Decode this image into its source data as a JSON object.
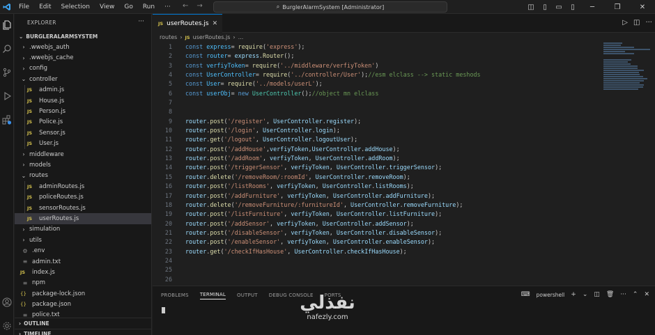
{
  "titlebar": {
    "menu": [
      "File",
      "Edit",
      "Selection",
      "View",
      "Go",
      "Run",
      "···"
    ],
    "search_text": "BurglerAlarmSystem [Administrator]"
  },
  "sidebar": {
    "title": "EXPLORER",
    "dots": "···",
    "root": "BURGLERALARMSYSTEM",
    "items": [
      {
        "label": ".wwebjs_auth",
        "kind": "folder",
        "depth": 0,
        "open": false
      },
      {
        "label": ".wwebjs_cache",
        "kind": "folder",
        "depth": 0,
        "open": false
      },
      {
        "label": "config",
        "kind": "folder",
        "depth": 0,
        "open": false
      },
      {
        "label": "controller",
        "kind": "folder",
        "depth": 0,
        "open": true
      },
      {
        "label": "admin.js",
        "kind": "js",
        "depth": 1
      },
      {
        "label": "House.js",
        "kind": "js",
        "depth": 1
      },
      {
        "label": "Person.js",
        "kind": "js",
        "depth": 1
      },
      {
        "label": "Police.js",
        "kind": "js",
        "depth": 1
      },
      {
        "label": "Sensor.js",
        "kind": "js",
        "depth": 1
      },
      {
        "label": "User.js",
        "kind": "js",
        "depth": 1
      },
      {
        "label": "middleware",
        "kind": "folder",
        "depth": 0,
        "open": false
      },
      {
        "label": "models",
        "kind": "folder",
        "depth": 0,
        "open": false
      },
      {
        "label": "routes",
        "kind": "folder",
        "depth": 0,
        "open": true
      },
      {
        "label": "adminRoutes.js",
        "kind": "js",
        "depth": 1
      },
      {
        "label": "policeRoutes.js",
        "kind": "js",
        "depth": 1
      },
      {
        "label": "sensorRoutes.js",
        "kind": "js",
        "depth": 1
      },
      {
        "label": "userRoutes.js",
        "kind": "js",
        "depth": 1,
        "selected": true
      },
      {
        "label": "simulation",
        "kind": "folder",
        "depth": 0,
        "open": false
      },
      {
        "label": "utils",
        "kind": "folder",
        "depth": 0,
        "open": false
      },
      {
        "label": ".env",
        "kind": "env",
        "depth": 0
      },
      {
        "label": "admin.txt",
        "kind": "txt",
        "depth": 0
      },
      {
        "label": "index.js",
        "kind": "js",
        "depth": 0
      },
      {
        "label": "npm",
        "kind": "txt",
        "depth": 0
      },
      {
        "label": "package-lock.json",
        "kind": "json",
        "depth": 0
      },
      {
        "label": "package.json",
        "kind": "json",
        "depth": 0
      },
      {
        "label": "police.txt",
        "kind": "txt",
        "depth": 0
      }
    ],
    "outline": "OUTLINE",
    "timeline": "TIMELINE"
  },
  "editor": {
    "tab_label": "userRoutes.js",
    "tab_icon": "JS",
    "breadcrumb": [
      "routes",
      "userRoutes.js",
      "..."
    ],
    "lines": [
      [
        [
          "kw",
          "const "
        ],
        [
          "var",
          "express"
        ],
        [
          "",
          "= "
        ],
        [
          "fn",
          "require"
        ],
        [
          "",
          "("
        ],
        [
          "str",
          "'express'"
        ],
        [
          "",
          ");"
        ]
      ],
      [
        [
          "kw",
          "const "
        ],
        [
          "var",
          "router"
        ],
        [
          "",
          "= "
        ],
        [
          "pl",
          "express"
        ],
        [
          "",
          "."
        ],
        [
          "fn",
          "Router"
        ],
        [
          "",
          "();"
        ]
      ],
      [
        [
          "kw",
          "const "
        ],
        [
          "var",
          "verfiyToken"
        ],
        [
          "",
          "= "
        ],
        [
          "fn",
          "require"
        ],
        [
          "",
          "("
        ],
        [
          "str",
          "'../middleware/verfiyToken'"
        ],
        [
          "",
          ")"
        ]
      ],
      [
        [
          "kw",
          "const "
        ],
        [
          "var",
          "UserController"
        ],
        [
          "",
          "= "
        ],
        [
          "fn",
          "require"
        ],
        [
          "",
          "("
        ],
        [
          "str",
          "'../controller/User'"
        ],
        [
          "",
          ");"
        ],
        [
          "cm",
          "//esm elclass --> static meshods"
        ]
      ],
      [
        [
          "kw",
          "const "
        ],
        [
          "var",
          "User"
        ],
        [
          "",
          "= "
        ],
        [
          "fn",
          "require"
        ],
        [
          "",
          "("
        ],
        [
          "str",
          "'../models/userL'"
        ],
        [
          "",
          ");"
        ]
      ],
      [
        [
          "kw",
          "const "
        ],
        [
          "var",
          "userObj"
        ],
        [
          "",
          "= "
        ],
        [
          "kw",
          "new "
        ],
        [
          "cls",
          "UserController"
        ],
        [
          "",
          "();"
        ],
        [
          "cm",
          "//object mn elclass"
        ]
      ],
      [],
      [],
      [
        [
          "pl",
          "router"
        ],
        [
          "",
          "."
        ],
        [
          "fn",
          "post"
        ],
        [
          "",
          "("
        ],
        [
          "str",
          "'/register'"
        ],
        [
          "",
          ", "
        ],
        [
          "pl",
          "UserController"
        ],
        [
          "",
          "."
        ],
        [
          "pl",
          "register"
        ],
        [
          "",
          ");"
        ]
      ],
      [
        [
          "pl",
          "router"
        ],
        [
          "",
          "."
        ],
        [
          "fn",
          "post"
        ],
        [
          "",
          "("
        ],
        [
          "str",
          "'/login'"
        ],
        [
          "",
          ", "
        ],
        [
          "pl",
          "UserController"
        ],
        [
          "",
          "."
        ],
        [
          "pl",
          "login"
        ],
        [
          "",
          ");"
        ]
      ],
      [
        [
          "pl",
          "router"
        ],
        [
          "",
          "."
        ],
        [
          "fn",
          "get"
        ],
        [
          "",
          "("
        ],
        [
          "str",
          "'/logout'"
        ],
        [
          "",
          ", "
        ],
        [
          "pl",
          "UserController"
        ],
        [
          "",
          "."
        ],
        [
          "pl",
          "logoutUser"
        ],
        [
          "",
          ");"
        ]
      ],
      [
        [
          "pl",
          "router"
        ],
        [
          "",
          "."
        ],
        [
          "fn",
          "post"
        ],
        [
          "",
          "("
        ],
        [
          "str",
          "'/addHouse'"
        ],
        [
          "",
          ","
        ],
        [
          "pl",
          "verfiyToken"
        ],
        [
          "",
          ","
        ],
        [
          "pl",
          "UserController"
        ],
        [
          "",
          "."
        ],
        [
          "pl",
          "addHouse"
        ],
        [
          "",
          ");"
        ]
      ],
      [
        [
          "pl",
          "router"
        ],
        [
          "",
          "."
        ],
        [
          "fn",
          "post"
        ],
        [
          "",
          "("
        ],
        [
          "str",
          "'/addRoom'"
        ],
        [
          "",
          ", "
        ],
        [
          "pl",
          "verfiyToken"
        ],
        [
          "",
          ", "
        ],
        [
          "pl",
          "UserController"
        ],
        [
          "",
          "."
        ],
        [
          "pl",
          "addRoom"
        ],
        [
          "",
          ");"
        ]
      ],
      [
        [
          "pl",
          "router"
        ],
        [
          "",
          "."
        ],
        [
          "fn",
          "post"
        ],
        [
          "",
          "("
        ],
        [
          "str",
          "'/triggerSensor'"
        ],
        [
          "",
          ", "
        ],
        [
          "pl",
          "verfiyToken"
        ],
        [
          "",
          ", "
        ],
        [
          "pl",
          "UserController"
        ],
        [
          "",
          "."
        ],
        [
          "pl",
          "triggerSensor"
        ],
        [
          "",
          ");"
        ]
      ],
      [
        [
          "pl",
          "router"
        ],
        [
          "",
          "."
        ],
        [
          "fn",
          "delete"
        ],
        [
          "",
          "("
        ],
        [
          "str",
          "'/removeRoom/:roomId'"
        ],
        [
          "",
          ", "
        ],
        [
          "pl",
          "UserController"
        ],
        [
          "",
          "."
        ],
        [
          "pl",
          "removeRoom"
        ],
        [
          "",
          ");"
        ]
      ],
      [
        [
          "pl",
          "router"
        ],
        [
          "",
          "."
        ],
        [
          "fn",
          "post"
        ],
        [
          "",
          "("
        ],
        [
          "str",
          "'/listRooms'"
        ],
        [
          "",
          ", "
        ],
        [
          "pl",
          "verfiyToken"
        ],
        [
          "",
          ", "
        ],
        [
          "pl",
          "UserController"
        ],
        [
          "",
          "."
        ],
        [
          "pl",
          "listRooms"
        ],
        [
          "",
          ");"
        ]
      ],
      [
        [
          "pl",
          "router"
        ],
        [
          "",
          "."
        ],
        [
          "fn",
          "post"
        ],
        [
          "",
          "("
        ],
        [
          "str",
          "'/addFurniture'"
        ],
        [
          "",
          ", "
        ],
        [
          "pl",
          "verfiyToken"
        ],
        [
          "",
          ", "
        ],
        [
          "pl",
          "UserController"
        ],
        [
          "",
          "."
        ],
        [
          "pl",
          "addFurniture"
        ],
        [
          "",
          ");"
        ]
      ],
      [
        [
          "pl",
          "router"
        ],
        [
          "",
          "."
        ],
        [
          "fn",
          "delete"
        ],
        [
          "",
          "("
        ],
        [
          "str",
          "'/removeFurniture/:furnitureId'"
        ],
        [
          "",
          ", "
        ],
        [
          "pl",
          "UserController"
        ],
        [
          "",
          "."
        ],
        [
          "pl",
          "removeFurniture"
        ],
        [
          "",
          ");"
        ]
      ],
      [
        [
          "pl",
          "router"
        ],
        [
          "",
          "."
        ],
        [
          "fn",
          "post"
        ],
        [
          "",
          "("
        ],
        [
          "str",
          "'/listFurniture'"
        ],
        [
          "",
          ", "
        ],
        [
          "pl",
          "verfiyToken"
        ],
        [
          "",
          ", "
        ],
        [
          "pl",
          "UserController"
        ],
        [
          "",
          "."
        ],
        [
          "pl",
          "listFurniture"
        ],
        [
          "",
          ");"
        ]
      ],
      [
        [
          "pl",
          "router"
        ],
        [
          "",
          "."
        ],
        [
          "fn",
          "post"
        ],
        [
          "",
          "("
        ],
        [
          "str",
          "'/addSensor'"
        ],
        [
          "",
          ", "
        ],
        [
          "pl",
          "verfiyToken"
        ],
        [
          "",
          ", "
        ],
        [
          "pl",
          "UserController"
        ],
        [
          "",
          "."
        ],
        [
          "pl",
          "addSensor"
        ],
        [
          "",
          ");"
        ]
      ],
      [
        [
          "pl",
          "router"
        ],
        [
          "",
          "."
        ],
        [
          "fn",
          "post"
        ],
        [
          "",
          "("
        ],
        [
          "str",
          "'/disableSensor'"
        ],
        [
          "",
          ", "
        ],
        [
          "pl",
          "verfiyToken"
        ],
        [
          "",
          ", "
        ],
        [
          "pl",
          "UserController"
        ],
        [
          "",
          "."
        ],
        [
          "pl",
          "disableSensor"
        ],
        [
          "",
          ");"
        ]
      ],
      [
        [
          "pl",
          "router"
        ],
        [
          "",
          "."
        ],
        [
          "fn",
          "post"
        ],
        [
          "",
          "("
        ],
        [
          "str",
          "'/enableSensor'"
        ],
        [
          "",
          ", "
        ],
        [
          "pl",
          "verfiyToken"
        ],
        [
          "",
          ", "
        ],
        [
          "pl",
          "UserController"
        ],
        [
          "",
          "."
        ],
        [
          "pl",
          "enableSensor"
        ],
        [
          "",
          ");"
        ]
      ],
      [
        [
          "pl",
          "router"
        ],
        [
          "",
          "."
        ],
        [
          "fn",
          "get"
        ],
        [
          "",
          "("
        ],
        [
          "str",
          "'/checkIfHasHouse'"
        ],
        [
          "",
          ", "
        ],
        [
          "pl",
          "UserController"
        ],
        [
          "",
          "."
        ],
        [
          "pl",
          "checkIfHasHouse"
        ],
        [
          "",
          ");"
        ]
      ],
      [],
      [],
      []
    ]
  },
  "panel": {
    "tabs": [
      "PROBLEMS",
      "TERMINAL",
      "OUTPUT",
      "DEBUG CONSOLE",
      "PORTS"
    ],
    "active_tab": "TERMINAL",
    "shell": "powershell"
  },
  "watermark": {
    "arabic": "نفذلي",
    "latin": "nafezly.com"
  }
}
